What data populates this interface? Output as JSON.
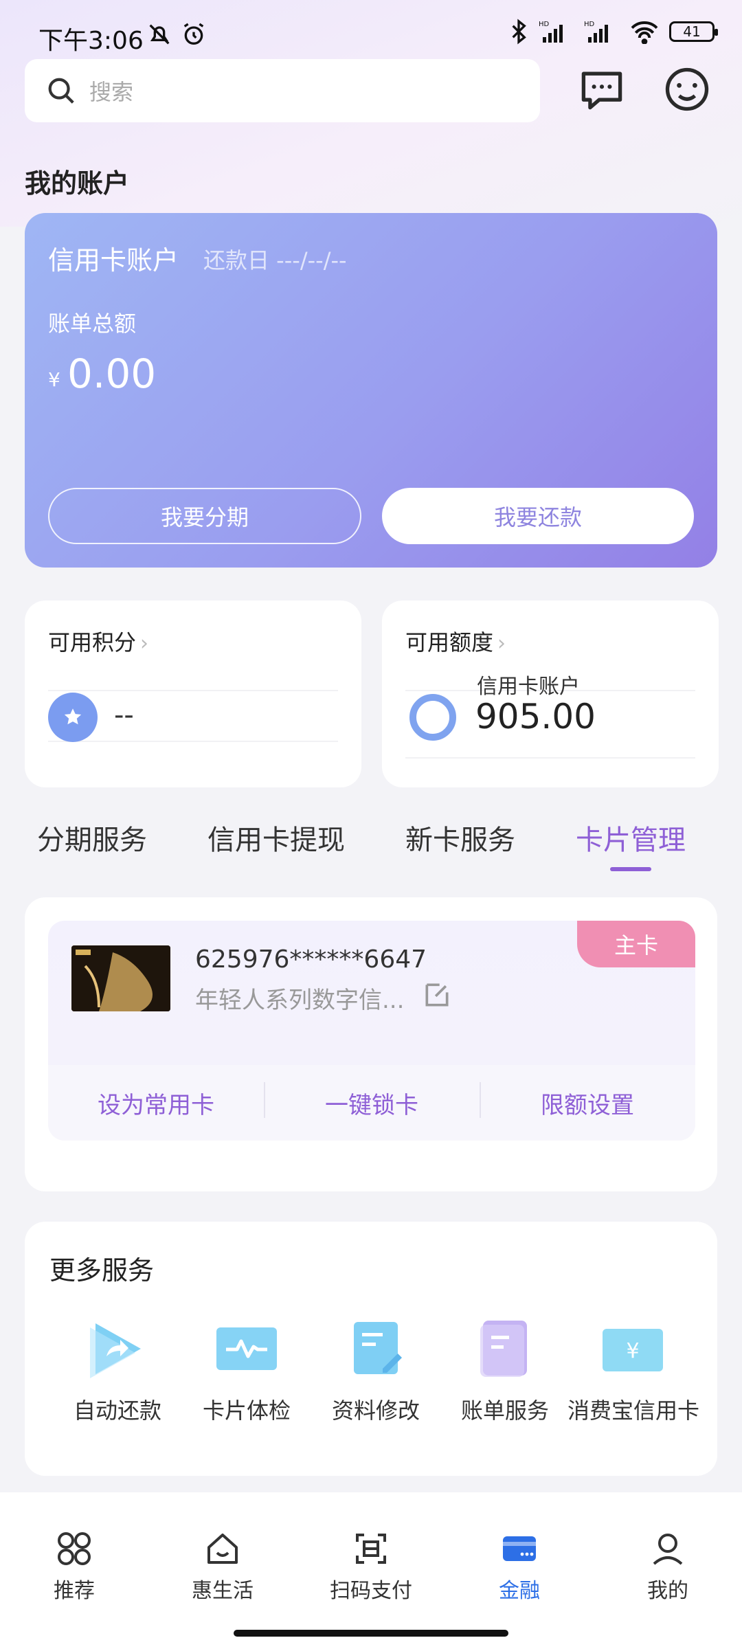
{
  "status": {
    "time": "下午3:06",
    "battery": "41"
  },
  "search": {
    "placeholder": "搜索"
  },
  "account": {
    "section_title": "我的账户",
    "card_title": "信用卡账户",
    "due_date": "还款日 ---/--/--",
    "bill_label": "账单总额",
    "currency": "¥",
    "bill_amount": "0.00",
    "btn_installment": "我要分期",
    "btn_repay": "我要还款"
  },
  "points": {
    "title": "可用积分",
    "value": "--"
  },
  "limit": {
    "title": "可用额度",
    "sub": "信用卡账户",
    "value": "905.00"
  },
  "tabs": [
    {
      "label": "分期服务"
    },
    {
      "label": "信用卡提现"
    },
    {
      "label": "新卡服务"
    },
    {
      "label": "卡片管理"
    }
  ],
  "card_mgmt": {
    "card_number": "625976******6647",
    "card_name": "年轻人系列数字信...",
    "tag": "主卡",
    "actions": [
      {
        "label": "设为常用卡"
      },
      {
        "label": "一键锁卡"
      },
      {
        "label": "限额设置"
      }
    ]
  },
  "more": {
    "title": "更多服务",
    "items": [
      {
        "label": "自动还款",
        "icon": "auto-repay-icon"
      },
      {
        "label": "卡片体检",
        "icon": "card-checkup-icon"
      },
      {
        "label": "资料修改",
        "icon": "edit-info-icon"
      },
      {
        "label": "账单服务",
        "icon": "bill-service-icon"
      },
      {
        "label": "消费宝信用卡",
        "icon": "yen-card-icon"
      }
    ]
  },
  "bottom_nav": [
    {
      "label": "推荐"
    },
    {
      "label": "惠生活"
    },
    {
      "label": "扫码支付"
    },
    {
      "label": "金融"
    },
    {
      "label": "我的"
    }
  ],
  "colors": {
    "accent": "#8e5fd6",
    "nav_active": "#2d6fe6",
    "card_gradient_start": "#9fb6f4",
    "card_gradient_end": "#9380e6",
    "tag": "#f08fb3"
  }
}
